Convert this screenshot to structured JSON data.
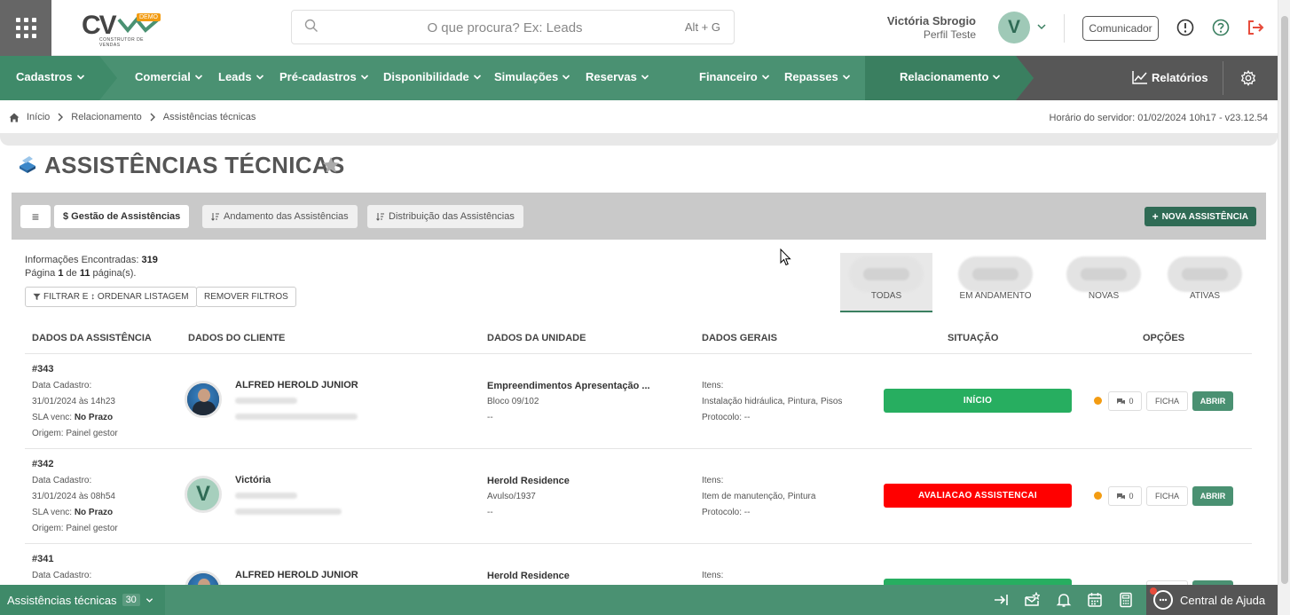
{
  "header": {
    "logo_text": "CV",
    "logo_badge": "DEMO",
    "logo_subtitle": "CONSTRUTOR DE VENDAS",
    "search_placeholder": "O que procura? Ex: Leads",
    "search_shortcut": "Alt + G",
    "user_name": "Victória Sbrogio",
    "user_role": "Perfil Teste",
    "avatar_letter": "V",
    "comunicador_label": "Comunicador"
  },
  "nav": {
    "items": [
      {
        "label": "Cadastros"
      },
      {
        "label": "Comercial"
      },
      {
        "label": "Leads"
      },
      {
        "label": "Pré-cadastros"
      },
      {
        "label": "Disponibilidade"
      },
      {
        "label": "Simulações"
      },
      {
        "label": "Reservas"
      },
      {
        "label": "Financeiro"
      },
      {
        "label": "Repasses"
      },
      {
        "label": "Relacionamento"
      }
    ],
    "relatorios": "Relatórios",
    "colors": {
      "primary": "#4a9172",
      "dark": "#3a7f60",
      "gray": "#575757"
    }
  },
  "breadcrumb": {
    "items": [
      "Início",
      "Relacionamento",
      "Assistências técnicas"
    ],
    "server_time": "Horário do servidor: 01/02/2024 10h17 - v23.12.54"
  },
  "page": {
    "title": "ASSISTÊNCIAS TÉCNICAS"
  },
  "toolbar": {
    "menu_icon": "≡",
    "tabs": [
      {
        "label": "$ Gestão de Assistências",
        "active": true
      },
      {
        "label": "Andamento das Assistências",
        "active": false
      },
      {
        "label": "Distribuição das Assistências",
        "active": false
      }
    ],
    "new_button": "NOVA ASSISTÊNCIA"
  },
  "info": {
    "found_label": "Informações Encontradas:",
    "found_count": "319",
    "page_prefix": "Página",
    "page_current": "1",
    "page_of": "de",
    "page_total": "11",
    "page_suffix": "página(s).",
    "filter_button": "FILTRAR E ↕ ORDENAR LISTAGEM",
    "remove_filters": "REMOVER FILTROS"
  },
  "status_tabs": [
    {
      "label": "TODAS",
      "active": true
    },
    {
      "label": "EM ANDAMENTO",
      "active": false
    },
    {
      "label": "NOVAS",
      "active": false
    },
    {
      "label": "ATIVAS",
      "active": false
    }
  ],
  "table": {
    "headers": [
      "DADOS DA ASSISTÊNCIA",
      "DADOS DO CLIENTE",
      "DADOS DA UNIDADE",
      "DADOS GERAIS",
      "SITUAÇÃO",
      "OPÇÕES"
    ],
    "rows": [
      {
        "id": "#343",
        "cadastro_label": "Data Cadastro:",
        "cadastro_value": "31/01/2024 às 14h23",
        "sla_label": "SLA venc:",
        "sla_value": "No Prazo",
        "origem": "Origem: Painel gestor",
        "client_name": "ALFRED HEROLD JUNIOR",
        "avatar_type": "photo",
        "unit_name": "Empreendimentos Apresentação ...",
        "unit_block": "Bloco 09/102",
        "unit_extra": "--",
        "itens_label": "Itens:",
        "itens_value": "Instalação hidráulica, Pintura, Pisos",
        "protocolo": "Protocolo: --",
        "status": "INÍCIO",
        "status_color": "#27ae60",
        "comments": "0",
        "ficha": "FICHA",
        "abrir": "ABRIR"
      },
      {
        "id": "#342",
        "cadastro_label": "Data Cadastro:",
        "cadastro_value": "31/01/2024 às 08h54",
        "sla_label": "SLA venc:",
        "sla_value": "No Prazo",
        "origem": "Origem: Painel gestor",
        "client_name": "Victória",
        "avatar_type": "letter",
        "avatar_letter": "V",
        "unit_name": "Herold Residence",
        "unit_block": "Avulso/1937",
        "unit_extra": "--",
        "itens_label": "Itens:",
        "itens_value": "Item de manutenção, Pintura",
        "protocolo": "Protocolo: --",
        "status": "AVALIACAO ASSISTENCAI",
        "status_color": "#ff0000",
        "comments": "0",
        "ficha": "FICHA",
        "abrir": "ABRIR"
      },
      {
        "id": "#341",
        "cadastro_label": "Data Cadastro:",
        "client_name": "ALFRED HEROLD JUNIOR",
        "avatar_type": "photo",
        "unit_name": "Herold Residence",
        "itens_label": "Itens:",
        "status_color": "#27ae60"
      }
    ]
  },
  "bottom": {
    "section": "Assistências técnicas",
    "count": "30",
    "help": "Central de Ajuda"
  }
}
